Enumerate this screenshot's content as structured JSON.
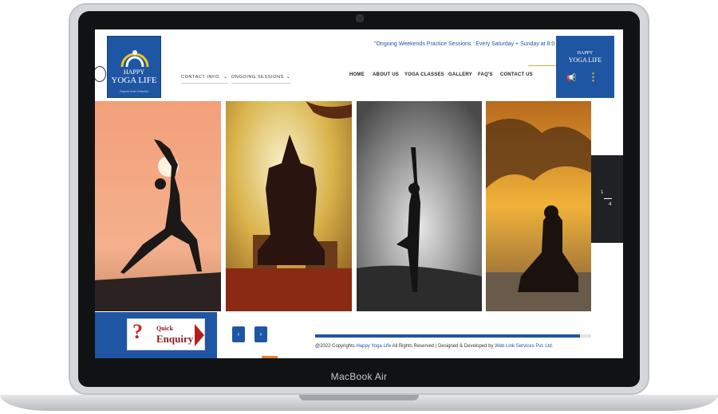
{
  "device": {
    "brand": "MacBook Air"
  },
  "header": {
    "logo": {
      "line1": "HAPPY",
      "line2": "YOGA LIFE",
      "tagline": "Explore Inner Potential"
    },
    "ticker": "\"Ongoing Weekends Practice Sessions : Every Saturday + Sunday at 8:0",
    "dropdowns": [
      {
        "label": "CONTACT INFO."
      },
      {
        "label": "ONGOING SESSIONS"
      }
    ],
    "nav": [
      {
        "label": "HOME"
      },
      {
        "label": "ABOUT US"
      },
      {
        "label": "YOGA CLASSES"
      },
      {
        "label": "GALLERY"
      },
      {
        "label": "FAQ'S"
      },
      {
        "label": "CONTACT US"
      }
    ],
    "sidebox": {
      "line1": "HAPPY",
      "line2": "YOGA LIFE",
      "megaphone_icon": "megaphone-icon",
      "menu_icon": "kebab-menu-icon"
    }
  },
  "slider": {
    "panels": [
      "warrior-pose-sunset",
      "seated-prayer-pose",
      "tree-pose-moon",
      "meditation-cloudy-sunset"
    ],
    "counter": {
      "current": "1",
      "total": "4"
    },
    "progress_fraction": 0.96,
    "prev_label": "‹",
    "next_label": "›"
  },
  "enquiry": {
    "line1": "Quick",
    "line2": "Enquiry",
    "mark": "?"
  },
  "footer": {
    "prefix": "@2022 Copyrights ",
    "site": "Happy Yoga Life",
    "middle": " All Rights Reserved | Designed & Developed by ",
    "developer": "Web Link Services Pvt. Ltd."
  },
  "colors": {
    "brand_blue": "#1f56a3",
    "accent_yellow": "#f5c518",
    "enquiry_red": "#8b1a1a"
  }
}
